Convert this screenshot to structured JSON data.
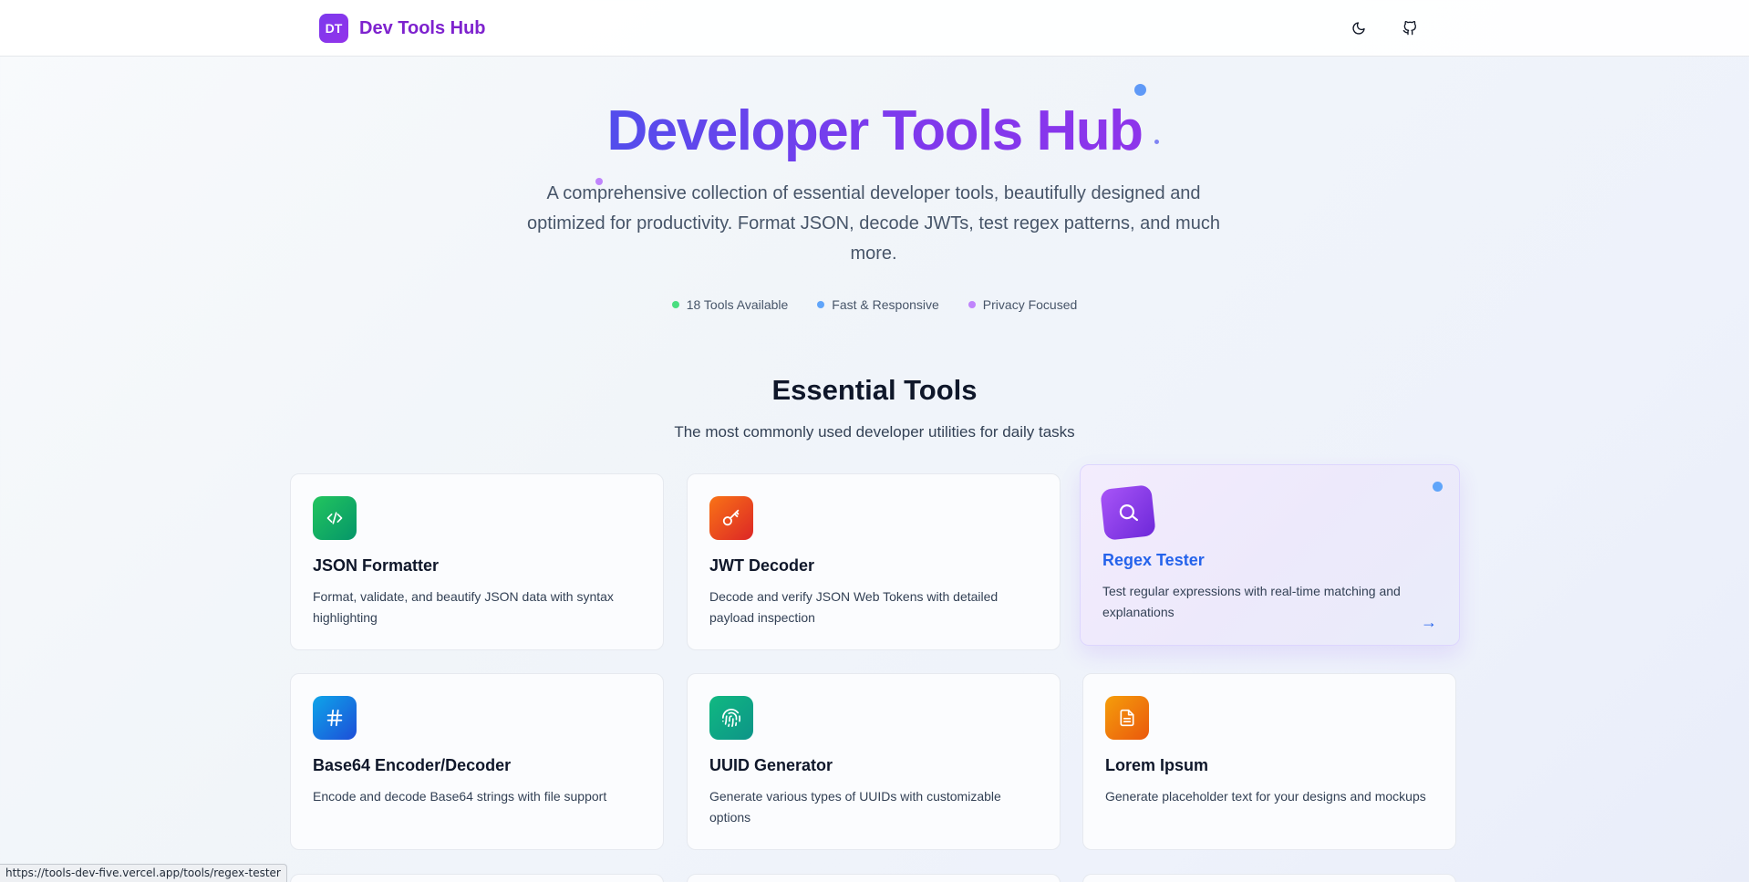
{
  "header": {
    "logo_text": "DT",
    "brand": "Dev Tools Hub",
    "theme_toggle_icon": "moon-icon",
    "github_icon": "github-icon"
  },
  "hero": {
    "title": "Developer Tools Hub",
    "subtitle": "A comprehensive collection of essential developer tools, beautifully designed and optimized for productivity. Format JSON, decode JWTs, test regex patterns, and much more.",
    "stats": [
      {
        "label": "18 Tools Available",
        "color": "#4ade80"
      },
      {
        "label": "Fast & Responsive",
        "color": "#60a5fa"
      },
      {
        "label": "Privacy Focused",
        "color": "#c084fc"
      }
    ]
  },
  "section": {
    "title": "Essential Tools",
    "subtitle": "The most commonly used developer utilities for daily tasks"
  },
  "tools": [
    {
      "title": "JSON Formatter",
      "description": "Format, validate, and beautify JSON data with syntax highlighting",
      "icon": "code-icon",
      "gradient": [
        "#22c55e",
        "#059669"
      ]
    },
    {
      "title": "JWT Decoder",
      "description": "Decode and verify JSON Web Tokens with detailed payload inspection",
      "icon": "key-icon",
      "gradient": [
        "#f97316",
        "#dc2626"
      ]
    },
    {
      "title": "Regex Tester",
      "description": "Test regular expressions with real-time matching and explanations",
      "icon": "search-icon",
      "gradient": [
        "#a855f7",
        "#6d28d9"
      ],
      "arrow": "→",
      "hovered": true
    },
    {
      "title": "Base64 Encoder/Decoder",
      "description": "Encode and decode Base64 strings with file support",
      "icon": "hash-icon",
      "gradient": [
        "#0ea5e9",
        "#1d4ed8"
      ]
    },
    {
      "title": "UUID Generator",
      "description": "Generate various types of UUIDs with customizable options",
      "icon": "fingerprint-icon",
      "gradient": [
        "#10b981",
        "#0d9488"
      ]
    },
    {
      "title": "Lorem Ipsum",
      "description": "Generate placeholder text for your designs and mockups",
      "icon": "document-icon",
      "gradient": [
        "#f59e0b",
        "#ea580c"
      ]
    }
  ],
  "status_bar": {
    "url": "https://tools-dev-five.vercel.app/tools/regex-tester"
  }
}
